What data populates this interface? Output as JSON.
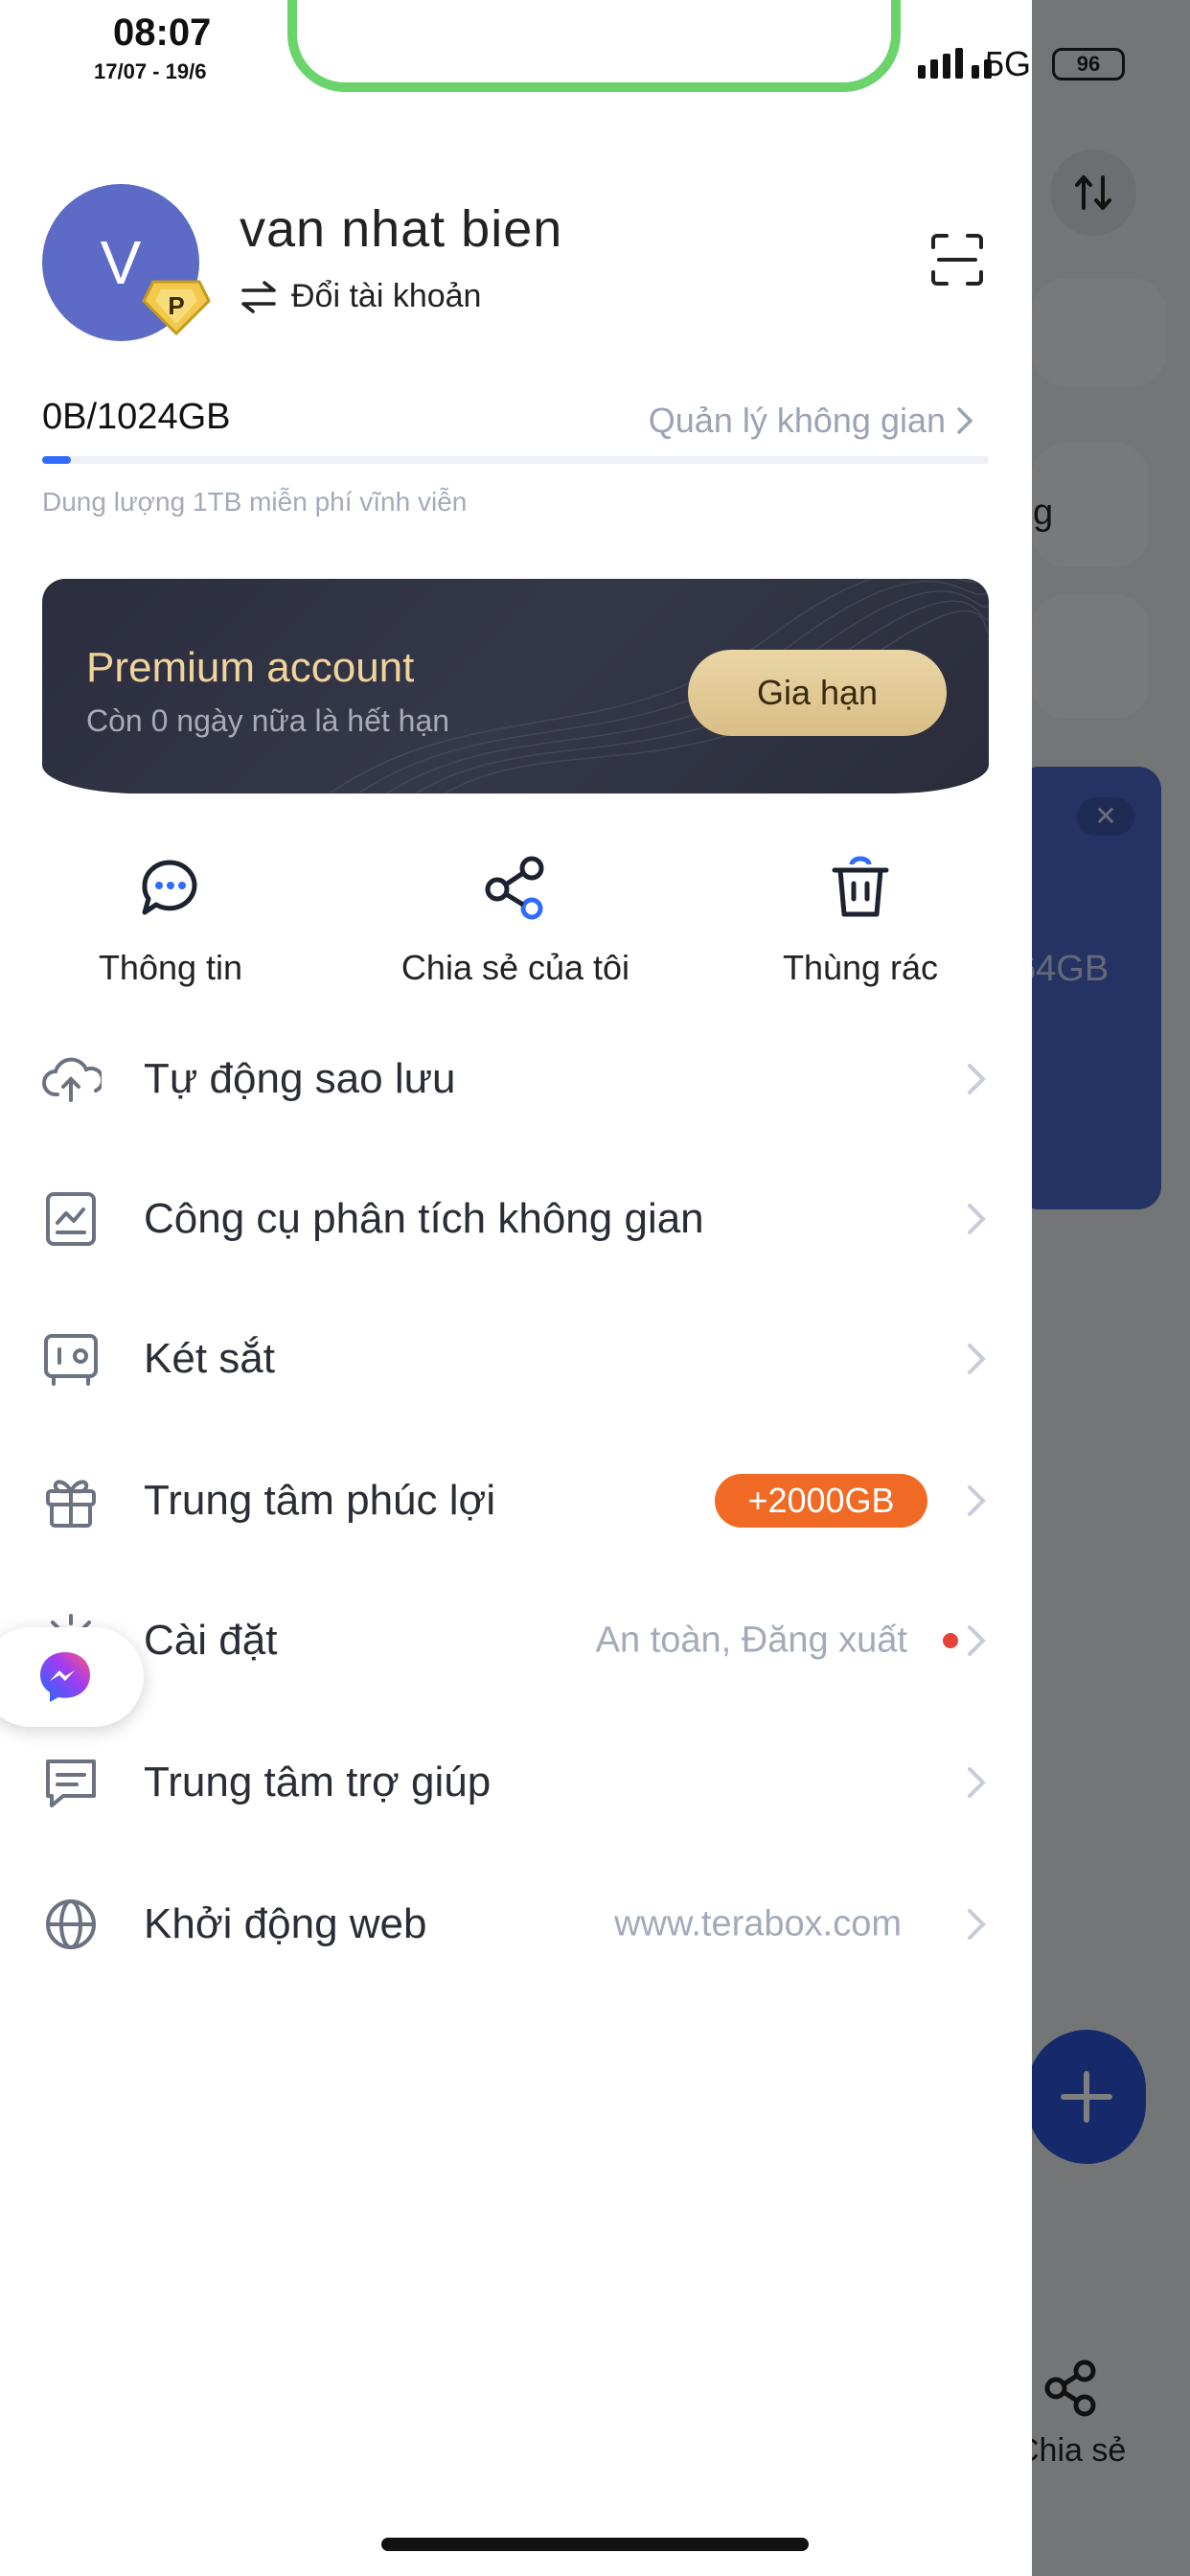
{
  "status_bar": {
    "time": "08:07",
    "date": "17/07 - 19/6",
    "network": "5G",
    "battery": "96"
  },
  "profile": {
    "avatar_letter": "V",
    "badge_letter": "P",
    "name": "van nhat bien",
    "switch_label": "Đổi tài khoản"
  },
  "storage": {
    "usage": "0B/1024GB",
    "manage_label": "Quản lý không gian",
    "free_note": "Dung lượng 1TB miễn phí vĩnh viễn",
    "used_fraction": 0.03
  },
  "premium": {
    "title": "Premium account",
    "subtitle": "Còn 0 ngày nữa là hết hạn",
    "button": "Gia hạn"
  },
  "quick_actions": [
    {
      "label": "Thông tin",
      "icon": "chat-bubble-icon"
    },
    {
      "label": "Chia sẻ của tôi",
      "icon": "share-icon"
    },
    {
      "label": "Thùng rác",
      "icon": "trash-icon"
    }
  ],
  "menu": [
    {
      "label": "Tự động sao lưu",
      "value": "",
      "icon": "cloud-upload-icon"
    },
    {
      "label": "Công cụ phân tích không gian",
      "value": "",
      "icon": "analysis-icon"
    },
    {
      "label": "Két sắt",
      "value": "",
      "icon": "safe-icon"
    },
    {
      "label": "Trung tâm phúc lợi",
      "value": "",
      "badge": "+2000GB",
      "icon": "gift-icon"
    },
    {
      "label": "Cài đặt",
      "value": "An toàn, Đăng xuất",
      "icon": "settings-icon"
    },
    {
      "label": "Trung tâm trợ giúp",
      "value": "",
      "icon": "help-icon"
    },
    {
      "label": "Khởi động web",
      "value": "www.terabox.com",
      "icon": "globe-icon"
    }
  ],
  "background": {
    "storage_suffix": "64GB",
    "share_label": "Chia sẻ",
    "partial_text": "g"
  },
  "colors": {
    "accent_blue": "#2f6bff",
    "badge_orange": "#f06a25",
    "premium_gold": "#f0d49a",
    "avatar": "#5d6bc7"
  }
}
